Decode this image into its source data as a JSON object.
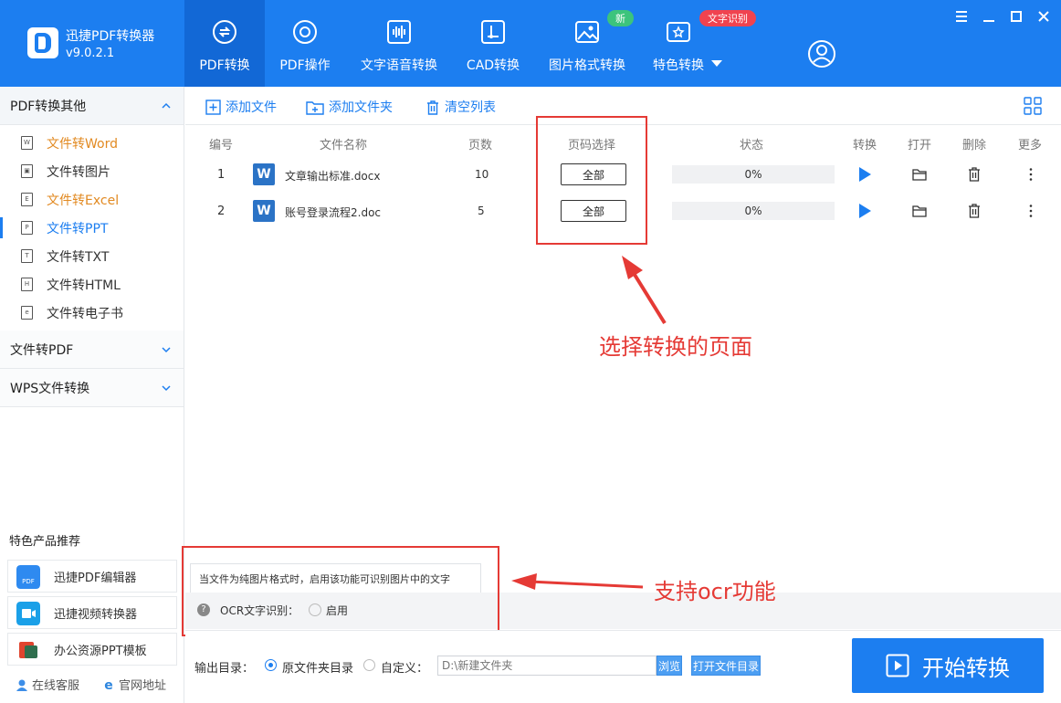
{
  "app": {
    "title": "迅捷PDF转换器",
    "version": "v9.0.2.1"
  },
  "nav": {
    "tabs": [
      {
        "label": "PDF转换",
        "icon": "pdf-convert-icon"
      },
      {
        "label": "PDF操作",
        "icon": "pdf-operate-icon"
      },
      {
        "label": "文字语音转换",
        "icon": "audio-wave-icon"
      },
      {
        "label": "CAD转换",
        "icon": "cad-icon"
      },
      {
        "label": "图片格式转换",
        "icon": "image-icon"
      },
      {
        "label": "特色转换",
        "icon": "special-convert-icon"
      }
    ],
    "badge_new": "新",
    "badge_ocr": "文字识别"
  },
  "sidebar": {
    "group1": "PDF转换其他",
    "items": [
      {
        "label": "文件转Word",
        "ico": "W"
      },
      {
        "label": "文件转图片",
        "ico": "▣"
      },
      {
        "label": "文件转Excel",
        "ico": "E"
      },
      {
        "label": "文件转PPT",
        "ico": "P"
      },
      {
        "label": "文件转TXT",
        "ico": "T"
      },
      {
        "label": "文件转HTML",
        "ico": "H"
      },
      {
        "label": "文件转电子书",
        "ico": "e"
      }
    ],
    "group2": "文件转PDF",
    "group3": "WPS文件转换",
    "promo_title": "特色产品推荐",
    "promos": [
      "迅捷PDF编辑器",
      "迅捷视频转换器",
      "办公资源PPT模板"
    ],
    "footer": {
      "service": "在线客服",
      "website": "官网地址"
    }
  },
  "toolbar": {
    "add_file": "添加文件",
    "add_folder": "添加文件夹",
    "clear_list": "清空列表"
  },
  "table": {
    "headers": {
      "index": "编号",
      "name": "文件名称",
      "pages": "页数",
      "page_select": "页码选择",
      "status": "状态",
      "convert": "转换",
      "open": "打开",
      "delete": "删除",
      "more": "更多"
    },
    "rows": [
      {
        "index": "1",
        "name": "文章输出标准.docx",
        "pages": "10",
        "range": "全部",
        "progress": "0%",
        "progress_value": 0
      },
      {
        "index": "2",
        "name": "账号登录流程2.doc",
        "pages": "5",
        "range": "全部",
        "progress": "0%",
        "progress_value": 0
      }
    ]
  },
  "annotations": {
    "page_select": "选择转换的页面",
    "ocr": "支持ocr功能"
  },
  "ocr": {
    "tip": "当文件为纯图片格式时，启用该功能可识别图片中的文字",
    "label": "OCR文字识别：",
    "enable": "启用"
  },
  "output": {
    "label": "输出目录：",
    "original": "原文件夹目录",
    "custom": "自定义：",
    "path_placeholder": "D:\\新建文件夹",
    "browse": "浏览",
    "open_dir": "打开文件目录"
  },
  "start_button": "开始转换",
  "colors": {
    "primary": "#1c7ef0",
    "annotation": "#e53a35",
    "orange": "#e28a22"
  }
}
